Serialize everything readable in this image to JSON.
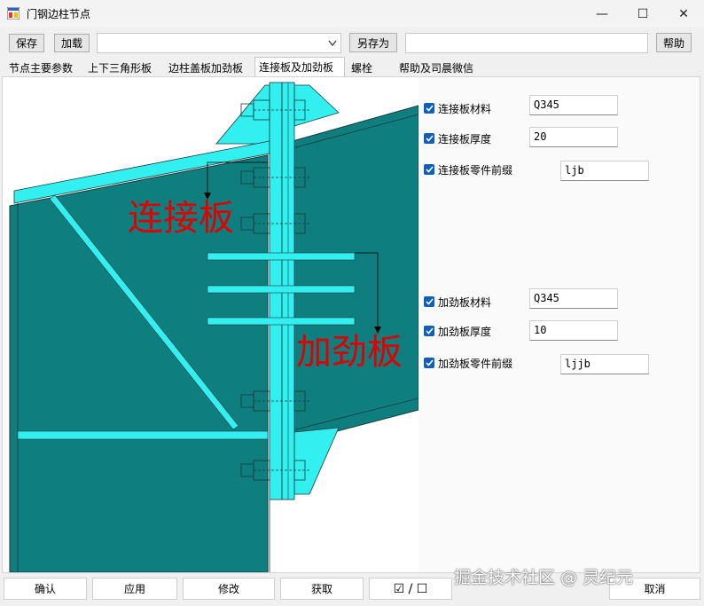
{
  "window": {
    "title": "门钢边柱节点",
    "controls": {
      "minimize": "—",
      "maximize": "☐",
      "close": "✕"
    }
  },
  "toolbar": {
    "save_label": "保存",
    "load_label": "加载",
    "preset_value": "",
    "save_as_label": "另存为",
    "name_value": "",
    "help_label": "帮助"
  },
  "tabs": [
    {
      "label": "节点主要参数"
    },
    {
      "label": "上下三角形板"
    },
    {
      "label": "边柱盖板加劲板"
    },
    {
      "label": "连接板及加劲板"
    },
    {
      "label": "螺栓"
    },
    {
      "label": "帮助及司晨微信"
    }
  ],
  "active_tab": "连接板及加劲板",
  "drawing": {
    "label_connection_plate": "连接板",
    "label_stiffener": "加劲板",
    "colors": {
      "column": "#0e7e7e",
      "plate": "#33f0f0",
      "outline": "#1a3a3a",
      "annotation": "#e00000"
    }
  },
  "connection_plate": {
    "material_label": "连接板材料",
    "material_value": "Q345",
    "thickness_label": "连接板厚度",
    "thickness_value": "20",
    "prefix_label": "连接板零件前缀",
    "prefix_value": "ljb"
  },
  "stiffener": {
    "material_label": "加劲板材料",
    "material_value": "Q345",
    "thickness_label": "加劲板厚度",
    "thickness_value": "10",
    "prefix_label": "加劲板零件前缀",
    "prefix_value": "ljjb"
  },
  "footer": {
    "ok_label": "确认",
    "apply_label": "应用",
    "modify_label": "修改",
    "get_label": "获取",
    "toggle_label": "☑ / ☐",
    "cancel_label": "取消"
  },
  "watermark": "掘金技术社区 @ 灵纪元"
}
